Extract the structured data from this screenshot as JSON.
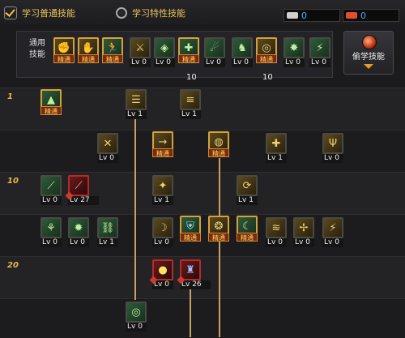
{
  "tabs": {
    "normal_label": "学习普通技能",
    "trait_label": "学习特性技能"
  },
  "resources": [
    {
      "icon": "sp-icon",
      "color": "#cfcfcf",
      "value": "0"
    },
    {
      "icon": "tp-icon",
      "color": "#e05030",
      "value": "0"
    }
  ],
  "common": {
    "label_line1": "通用",
    "label_line2": "技能",
    "mastered_label": "精通",
    "counts": [
      "10",
      "10"
    ]
  },
  "steal_button": {
    "label": "偷学技能"
  },
  "level_markers": [
    "1",
    "10",
    "20"
  ],
  "colors": {
    "accent": "#e6b84a",
    "line": "#c8a060",
    "bg": "#1b1b1d"
  },
  "skills_text": {
    "lv0": "Lv 0",
    "lv1": "Lv 1",
    "lv27": "Lv 27",
    "lv26": "Lv 26",
    "mastered": "精通"
  }
}
